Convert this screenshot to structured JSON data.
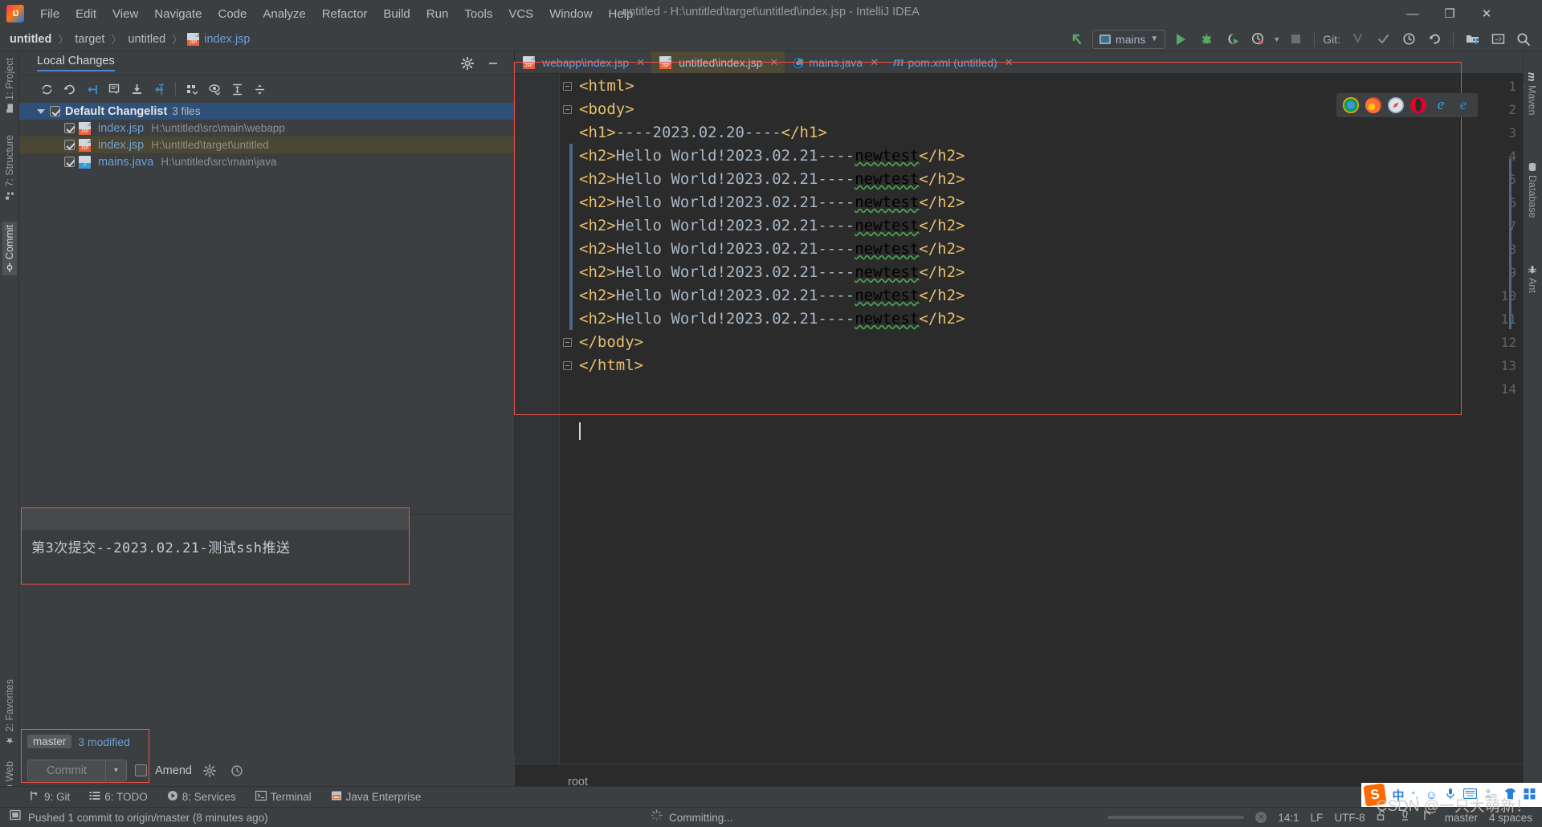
{
  "window": {
    "title": "untitled - H:\\untitled\\target\\untitled\\index.jsp - IntelliJ IDEA",
    "minimize": "—",
    "maximize": "❐",
    "close": "✕"
  },
  "menubar": {
    "items": [
      "File",
      "Edit",
      "View",
      "Navigate",
      "Code",
      "Analyze",
      "Refactor",
      "Build",
      "Run",
      "Tools",
      "VCS",
      "Window",
      "Help"
    ]
  },
  "breadcrumb": {
    "items": [
      "untitled",
      "target",
      "untitled",
      "index.jsp"
    ],
    "separator": "〉"
  },
  "toolbar": {
    "run_config": "mains",
    "git_label": "Git:",
    "icons": [
      "back-arrow-icon",
      "run-icon",
      "debug-icon",
      "run-coverage-icon",
      "profiler-icon",
      "stop-icon",
      "update-project-icon",
      "commit-icon",
      "history-icon",
      "rollback-icon",
      "project-structure-icon",
      "terminal-icon",
      "search-everywhere-icon"
    ]
  },
  "stripe_left": {
    "items": [
      {
        "label": "1: Project",
        "icon": "folder-icon",
        "active": false
      },
      {
        "label": "7: Structure",
        "icon": "structure-icon",
        "active": false
      },
      {
        "label": "Commit",
        "icon": "commit-icon",
        "active": true
      },
      {
        "label": "2: Favorites",
        "icon": "star-icon",
        "active": false
      },
      {
        "label": "Web",
        "icon": "web-icon",
        "active": false
      }
    ]
  },
  "stripe_right": {
    "items": [
      {
        "label": "Maven",
        "icon": "maven-icon"
      },
      {
        "label": "Database",
        "icon": "database-icon"
      },
      {
        "label": "Ant",
        "icon": "ant-icon"
      }
    ]
  },
  "local_changes": {
    "tab_label": "Local Changes",
    "toolbar_icons": [
      "refresh-icon",
      "rollback-icon",
      "shelve-silently-icon",
      "show-diff-icon",
      "get-from-vcs-icon",
      "shelve-icon",
      "group-by-icon",
      "preview-icon",
      "expand-all-icon",
      "collapse-all-icon"
    ],
    "settings_icon": "gear-icon",
    "hide_icon": "minimize-icon",
    "changelist": {
      "name": "Default Changelist",
      "count": "3 files",
      "checked": true,
      "expanded": true
    },
    "files": [
      {
        "name": "index.jsp",
        "path": "H:\\untitled\\src\\main\\webapp",
        "icon": "jsp-file-icon",
        "checked": true,
        "selected": false
      },
      {
        "name": "index.jsp",
        "path": "H:\\untitled\\target\\untitled",
        "icon": "jsp-file-icon",
        "checked": true,
        "selected": true
      },
      {
        "name": "mains.java",
        "path": "H:\\untitled\\src\\main\\java",
        "icon": "java-file-icon",
        "checked": true,
        "selected": false
      }
    ]
  },
  "commit_form": {
    "message": "第3次提交--2023.02.21-测试ssh推送",
    "branch": "master",
    "modified_count": "3 modified",
    "commit_button": "Commit",
    "commit_dropdown": "▾",
    "amend_label": "Amend",
    "amend_checked": false,
    "gear_icon": "gear-icon",
    "history_icon": "history-icon"
  },
  "editor": {
    "tabs": [
      {
        "label": "webapp\\index.jsp",
        "icon": "jsp-file-icon",
        "active": false,
        "close": "✕"
      },
      {
        "label": "untitled\\index.jsp",
        "icon": "jsp-file-icon",
        "active": true,
        "close": "✕"
      },
      {
        "label": "mains.java",
        "icon": "java-class-icon",
        "active": false,
        "close": "✕"
      },
      {
        "label": "pom.xml (untitled)",
        "icon": "maven-icon",
        "active": false,
        "close": "✕"
      }
    ],
    "line_numbers": [
      "1",
      "2",
      "3",
      "4",
      "5",
      "6",
      "7",
      "8",
      "9",
      "10",
      "11",
      "12",
      "13",
      "14"
    ],
    "lines": [
      {
        "n": 1,
        "segs": [
          {
            "t": "<html>",
            "c": "tag"
          }
        ],
        "fold": true
      },
      {
        "n": 2,
        "segs": [
          {
            "t": "<body>",
            "c": "tag"
          }
        ],
        "fold": true
      },
      {
        "n": 3,
        "segs": [
          {
            "t": "<h1>",
            "c": "tag"
          },
          {
            "t": "----2023.02.20----",
            "c": "txt"
          },
          {
            "t": "</h1>",
            "c": "tag"
          }
        ],
        "fold": false
      },
      {
        "n": 4,
        "segs": [
          {
            "t": "<h2>",
            "c": "tag"
          },
          {
            "t": "Hello World!2023.02.21----",
            "c": "txt"
          },
          {
            "t": "newtest",
            "c": "sq"
          },
          {
            "t": "</h2>",
            "c": "tag"
          }
        ],
        "fold": false
      },
      {
        "n": 5,
        "segs": [
          {
            "t": "<h2>",
            "c": "tag"
          },
          {
            "t": "Hello World!2023.02.21----",
            "c": "txt"
          },
          {
            "t": "newtest",
            "c": "sq"
          },
          {
            "t": "</h2>",
            "c": "tag"
          }
        ],
        "fold": false
      },
      {
        "n": 6,
        "segs": [
          {
            "t": "<h2>",
            "c": "tag"
          },
          {
            "t": "Hello World!2023.02.21----",
            "c": "txt"
          },
          {
            "t": "newtest",
            "c": "sq"
          },
          {
            "t": "</h2>",
            "c": "tag"
          }
        ],
        "fold": false
      },
      {
        "n": 7,
        "segs": [
          {
            "t": "<h2>",
            "c": "tag"
          },
          {
            "t": "Hello World!2023.02.21----",
            "c": "txt"
          },
          {
            "t": "newtest",
            "c": "sq"
          },
          {
            "t": "</h2>",
            "c": "tag"
          }
        ],
        "fold": false
      },
      {
        "n": 8,
        "segs": [
          {
            "t": "<h2>",
            "c": "tag"
          },
          {
            "t": "Hello World!2023.02.21----",
            "c": "txt"
          },
          {
            "t": "newtest",
            "c": "sq"
          },
          {
            "t": "</h2>",
            "c": "tag"
          }
        ],
        "fold": false
      },
      {
        "n": 9,
        "segs": [
          {
            "t": "<h2>",
            "c": "tag"
          },
          {
            "t": "Hello World!2023.02.21----",
            "c": "txt"
          },
          {
            "t": "newtest",
            "c": "sq"
          },
          {
            "t": "</h2>",
            "c": "tag"
          }
        ],
        "fold": false
      },
      {
        "n": 10,
        "segs": [
          {
            "t": "<h2>",
            "c": "tag"
          },
          {
            "t": "Hello World!2023.02.21----",
            "c": "txt"
          },
          {
            "t": "newtest",
            "c": "sq"
          },
          {
            "t": "</h2>",
            "c": "tag"
          }
        ],
        "fold": false
      },
      {
        "n": 11,
        "segs": [
          {
            "t": "<h2>",
            "c": "tag"
          },
          {
            "t": "Hello World!2023.02.21----",
            "c": "txt"
          },
          {
            "t": "newtest",
            "c": "sq"
          },
          {
            "t": "</h2>",
            "c": "tag"
          }
        ],
        "fold": false
      },
      {
        "n": 12,
        "segs": [
          {
            "t": "</body>",
            "c": "tag"
          }
        ],
        "fold": true
      },
      {
        "n": 13,
        "segs": [
          {
            "t": "</html>",
            "c": "tag"
          }
        ],
        "fold": true
      },
      {
        "n": 14,
        "segs": [],
        "fold": false
      }
    ],
    "breadcrumb": "root",
    "browsers": [
      "chrome-icon",
      "firefox-icon",
      "safari-icon",
      "opera-icon",
      "internet-explorer-icon",
      "edge-icon"
    ]
  },
  "bottom_strip": {
    "items": [
      {
        "label": "9: Git",
        "mnemonic": "9",
        "icon": "git-branch-icon"
      },
      {
        "label": "6: TODO",
        "mnemonic": "6",
        "icon": "todo-list-icon"
      },
      {
        "label": "8: Services",
        "mnemonic": "8",
        "icon": "services-icon"
      },
      {
        "label": "Terminal",
        "mnemonic": "",
        "icon": "terminal-icon"
      },
      {
        "label": "Java Enterprise",
        "mnemonic": "",
        "icon": "java-enterprise-icon"
      }
    ]
  },
  "statusbar": {
    "message": "Pushed 1 commit to origin/master (8 minutes ago)",
    "message_icon": "event-log-icon",
    "progress_label": "Committing...",
    "progress_spinner": "spinner-icon",
    "caret": "14:1",
    "line_separator": "LF",
    "encoding": "UTF-8",
    "lock_icon": "unlocked-icon",
    "inspection_icon": "inspector-icon",
    "branch_icon": "git-branch-icon",
    "branch": "master",
    "indent": "4 spaces",
    "cancel_icon": "cancel-icon"
  },
  "tray": {
    "items": [
      "sogou-logo-icon",
      "chinese-mode-icon",
      "punctuation-icon",
      "emoji-icon",
      "microphone-icon",
      "keyboard-icon",
      "user-switch-icon",
      "skin-icon",
      "toolbox-icon"
    ]
  },
  "watermark": "CSDN @一只大萌新！",
  "colors": {
    "accent_blue": "#4a88c7",
    "selection_blue": "#2f5079",
    "selected_row": "#4b4732",
    "red_highlight": "#e8524a",
    "green_run": "#59a869",
    "tag_yellow": "#e8bf6a",
    "text_grey": "#a9b7c6",
    "link_blue": "#6e9fd4",
    "bg_dark": "#2b2b2b",
    "bg_panel": "#3c3f41"
  }
}
